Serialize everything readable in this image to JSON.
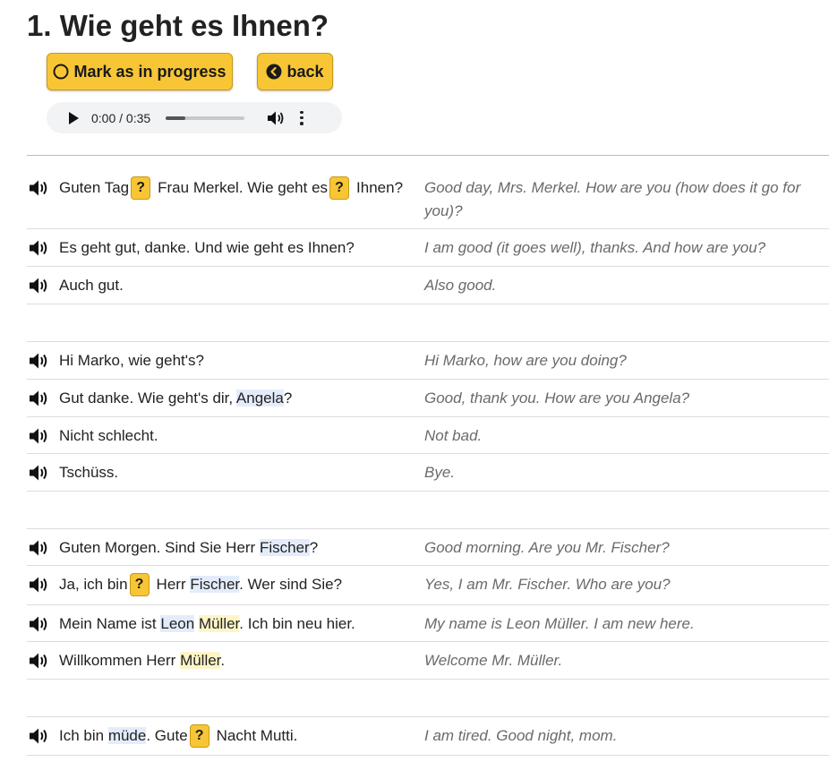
{
  "lesson": {
    "title": "1. Wie geht es Ihnen?",
    "progress_button_label": "Mark as in progress",
    "back_button_label": "back"
  },
  "audio": {
    "current_time": "0:00",
    "separator": "/",
    "duration": "0:35",
    "buffered_fraction": 0.25
  },
  "colors": {
    "button_bg": "#f8c635",
    "highlight_blue": "#e4ecfb",
    "highlight_yellow": "#fdf5c6",
    "translation_text": "#6a6a6a"
  },
  "dialogues": [
    {
      "lines": [
        {
          "german": [
            "Guten Tag",
            "?",
            "Frau Merkel. Wie geht es",
            "?",
            "Ihnen?"
          ],
          "english": "Good day, Mrs. Merkel. How are you (how does it go for you)?"
        },
        {
          "german": [
            "Es geht gut, danke. Und wie geht es Ihnen?"
          ],
          "english": "I am good (it goes well), thanks. And how are you?"
        },
        {
          "german": [
            "Auch gut."
          ],
          "english": "Also good."
        }
      ]
    },
    {
      "lines": [
        {
          "german": [
            "Hi Marko, wie geht's?"
          ],
          "english": "Hi Marko, how are you doing?"
        },
        {
          "german": [
            "Gut danke. Wie geht's dir, ",
            "Angela",
            "?"
          ],
          "english": "Good, thank you. How are you Angela?"
        },
        {
          "german": [
            "Nicht schlecht."
          ],
          "english": "Not bad."
        },
        {
          "german": [
            "Tschüss."
          ],
          "english": "Bye."
        }
      ]
    },
    {
      "lines": [
        {
          "german": [
            "Guten Morgen. Sind Sie Herr ",
            "Fischer",
            "?"
          ],
          "english": "Good morning. Are you Mr. Fischer?"
        },
        {
          "german": [
            "Ja, ich bin",
            "?",
            "Herr ",
            "Fischer",
            ". Wer sind Sie?"
          ],
          "english": "Yes, I am Mr. Fischer. Who are you?"
        },
        {
          "german": [
            "Mein Name ist ",
            "Leon",
            " ",
            "Müller",
            ". Ich bin neu hier."
          ],
          "english": "My name is Leon Müller. I am new here."
        },
        {
          "german": [
            "Willkommen Herr ",
            "Müller",
            "."
          ],
          "english": "Welcome Mr. Müller."
        }
      ]
    },
    {
      "lines": [
        {
          "german": [
            "Ich bin ",
            "müde",
            ". Gute",
            "?",
            "Nacht Mutti."
          ],
          "english": "I am tired. Good night, mom."
        }
      ]
    }
  ]
}
